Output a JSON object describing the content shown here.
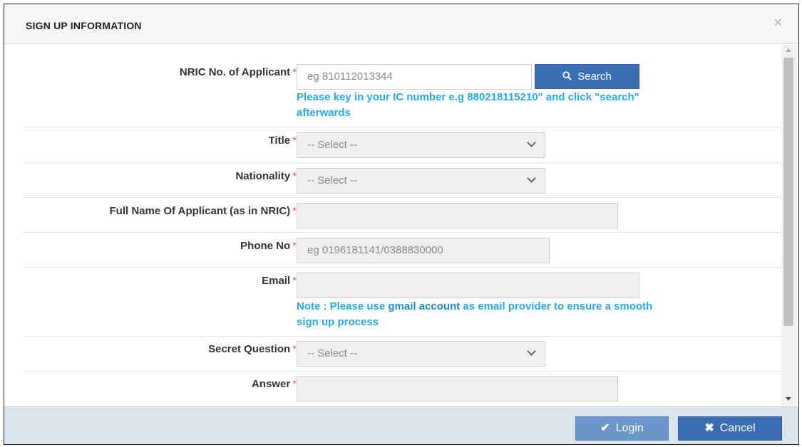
{
  "dialog": {
    "title": "SIGN UP INFORMATION",
    "close_icon": "close-icon"
  },
  "form": {
    "nric": {
      "label": "NRIC No. of Applicant",
      "required": "*",
      "placeholder": "eg 810112013344",
      "search_label": "Search",
      "search_icon": "search-icon",
      "help_line1": "Please key in your IC number e.g 880218115210\" and click \"search\"",
      "help_line2": "afterwards"
    },
    "title": {
      "label": "Title",
      "required": "*",
      "selected": "-- Select --"
    },
    "nationality": {
      "label": "Nationality",
      "required": "*",
      "selected": "-- Select --"
    },
    "full_name": {
      "label": "Full Name Of Applicant (as in NRIC)",
      "required": "*",
      "value": ""
    },
    "phone": {
      "label": "Phone No",
      "required": "*",
      "placeholder": "eg 0196181141/0388830000"
    },
    "email": {
      "label": "Email",
      "required": "*",
      "value": "",
      "note_prefix": "Note : Please use ",
      "note_bold": "gmail account",
      "note_suffix": " as email provider to ensure a smooth",
      "note_line2": "sign up process"
    },
    "secret_question": {
      "label": "Secret Question",
      "required": "*",
      "selected": "-- Select --"
    },
    "answer": {
      "label": "Answer",
      "required": "*",
      "value": ""
    }
  },
  "footer": {
    "login_label": "Login",
    "login_icon": "checkmark-icon",
    "cancel_label": "Cancel",
    "cancel_icon": "x-icon"
  },
  "colors": {
    "primary_button": "#3a70b3",
    "disabled_button": "#6a96c9",
    "help_text": "#27a9e3",
    "required_star": "#e05a5a",
    "footer_bg": "#dde4ec"
  }
}
